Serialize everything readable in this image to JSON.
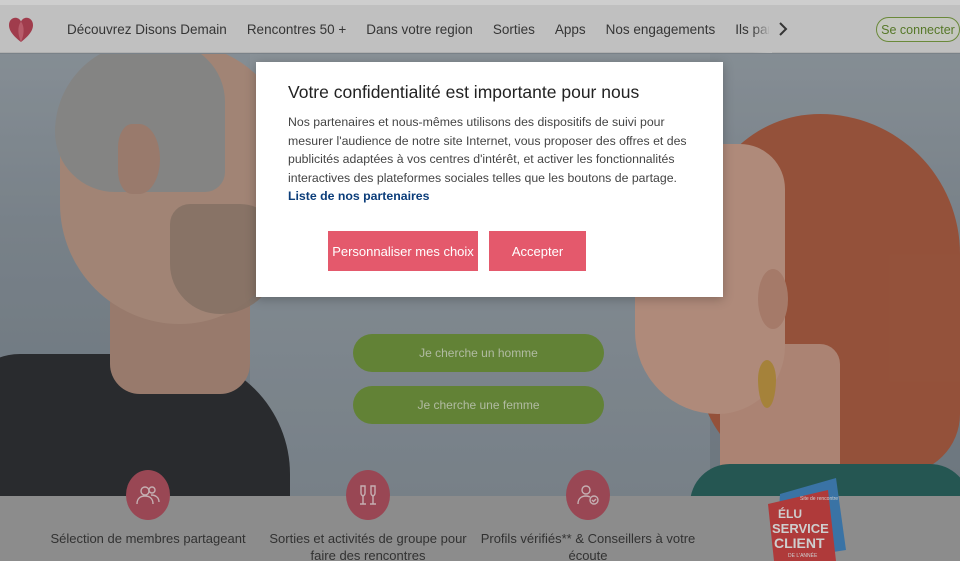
{
  "nav": {
    "logo_icon": "heart-logo-icon",
    "items": [
      {
        "label": "Découvrez Disons Demain"
      },
      {
        "label": "Rencontres 50 +"
      },
      {
        "label": "Dans votre region"
      },
      {
        "label": "Sorties"
      },
      {
        "label": "Apps"
      },
      {
        "label": "Nos engagements"
      },
      {
        "label": "Ils parlent de"
      }
    ],
    "next_icon": "chevron-right-icon",
    "login_label": "Se connecter"
  },
  "hero": {
    "cta_man": "Je cherche un homme",
    "cta_woman": "Je cherche une femme"
  },
  "features": [
    {
      "icon": "people-icon",
      "text": "Sélection de membres partageant"
    },
    {
      "icon": "champagne-glasses-icon",
      "text": "Sorties et activités de groupe pour faire des rencontres"
    },
    {
      "icon": "verified-profile-icon",
      "text": "Profils vérifiés** & Conseillers à votre écoute"
    }
  ],
  "award": {
    "line1": "ÉLU",
    "line2": "SERVICE",
    "line3": "CLIENT",
    "line4": "DE L'ANNÉE",
    "top": "Site de rencontre"
  },
  "consent": {
    "title": "Votre confidentialité est importante pour nous",
    "body": "Nos partenaires et nous-mêmes utilisons des dispositifs de suivi pour mesurer l'audience de notre site Internet, vous proposer des offres et des publicités adaptées à vos centres d'intérêt, et activer les fonctionnalités interactives des plateformes sociales telles que les boutons de partage.",
    "link": "Liste de nos partenaires",
    "customize_label": "Personnaliser mes choix",
    "accept_label": "Accepter"
  },
  "colors": {
    "brand_pink": "#e4596c",
    "brand_green": "#6f9a35",
    "link_blue": "#0b3d7a"
  }
}
